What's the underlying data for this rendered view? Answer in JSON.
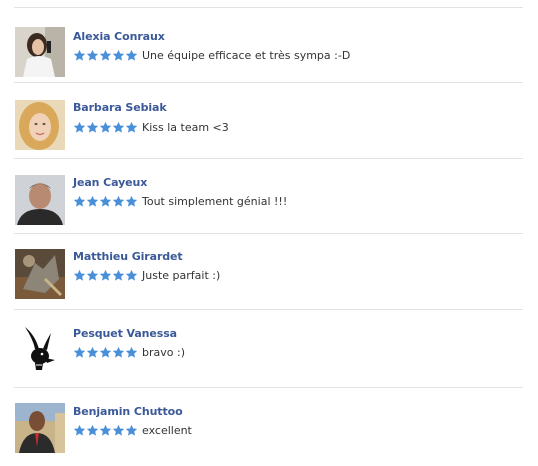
{
  "reviews": [
    {
      "name": "Alexia Conraux",
      "rating": 5,
      "comment": "Une équipe efficace et très sympa :-D",
      "avatar": "woman-phone-avatar"
    },
    {
      "name": "Barbara Sebiak",
      "rating": 5,
      "comment": "Kiss la team <3",
      "avatar": "blonde-woman-avatar"
    },
    {
      "name": "Jean Cayeux",
      "rating": 5,
      "comment": "Tout simplement génial !!!",
      "avatar": "man-avatar"
    },
    {
      "name": "Matthieu Girardet",
      "rating": 5,
      "comment": "Juste parfait :)",
      "avatar": "game-art-avatar"
    },
    {
      "name": "Pesquet Vanessa",
      "rating": 5,
      "comment": "bravo :)",
      "avatar": "bunny-logo-avatar"
    },
    {
      "name": "Benjamin Chuttoo",
      "rating": 5,
      "comment": "excellent",
      "avatar": "man-suit-avatar"
    }
  ],
  "colors": {
    "name": "#3b5998",
    "star": "#4a90d9",
    "divider": "#e2e2e2"
  }
}
